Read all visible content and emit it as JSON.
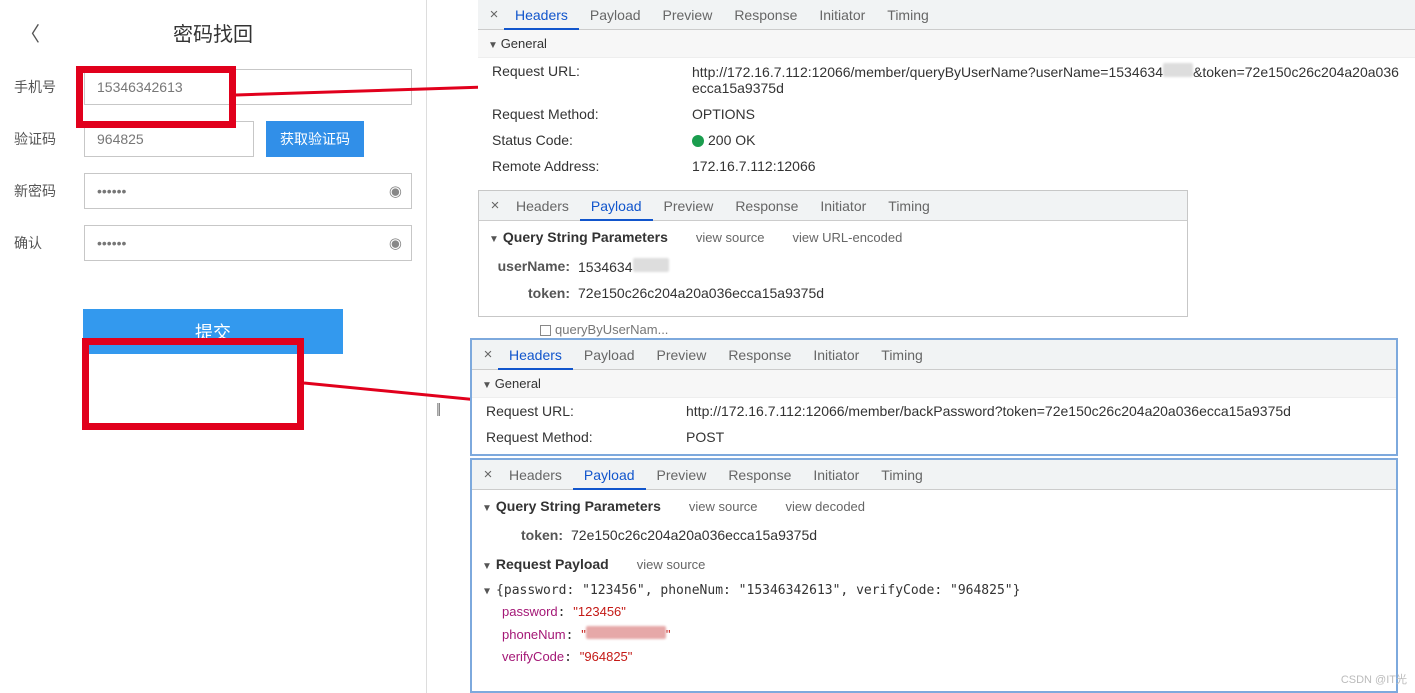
{
  "form": {
    "title": "密码找回",
    "labels": {
      "phone": "手机号",
      "code": "验证码",
      "newpwd": "新密码",
      "confirm": "确认"
    },
    "values": {
      "phone": "15346342613",
      "code": "964825",
      "newpwd_mask": "••••••",
      "confirm_mask": "••••••"
    },
    "get_code_btn": "获取验证码",
    "submit_btn": "提交"
  },
  "devtools1": {
    "tabs": [
      "Headers",
      "Payload",
      "Preview",
      "Response",
      "Initiator",
      "Timing"
    ],
    "active_tab": "Headers",
    "general_label": "General",
    "rows": {
      "req_url_k": "Request URL:",
      "req_url_v_p1": "http://172.16.7.112:12066/member/queryByUserName?userName=1534634",
      "req_url_v_p2": "&token=72e150c26c204a20a036ecca15a9375d",
      "req_method_k": "Request Method:",
      "req_method_v": "OPTIONS",
      "status_k": "Status Code:",
      "status_v": "200 OK",
      "remote_k": "Remote Address:",
      "remote_v": "172.16.7.112:12066"
    }
  },
  "devtools2": {
    "tabs": [
      "Headers",
      "Payload",
      "Preview",
      "Response",
      "Initiator",
      "Timing"
    ],
    "active_tab": "Payload",
    "qsp_label": "Query String Parameters",
    "view_source": "view source",
    "view_url": "view URL-encoded",
    "params": {
      "userName_k": "userName:",
      "userName_v": "1534634",
      "token_k": "token:",
      "token_v": "72e150c26c204a20a036ecca15a9375d"
    }
  },
  "network_item_label": "queryByUserNam...",
  "devtools3": {
    "tabs": [
      "Headers",
      "Payload",
      "Preview",
      "Response",
      "Initiator",
      "Timing"
    ],
    "active_tab": "Headers",
    "general_label": "General",
    "rows": {
      "req_url_k": "Request URL:",
      "req_url_v": "http://172.16.7.112:12066/member/backPassword?token=72e150c26c204a20a036ecca15a9375d",
      "req_method_k": "Request Method:",
      "req_method_v": "POST"
    }
  },
  "devtools4": {
    "tabs": [
      "Headers",
      "Payload",
      "Preview",
      "Response",
      "Initiator",
      "Timing"
    ],
    "active_tab": "Payload",
    "qsp_label": "Query String Parameters",
    "view_source": "view source",
    "view_decoded": "view decoded",
    "token_k": "token:",
    "token_v": "72e150c26c204a20a036ecca15a9375d",
    "rp_label": "Request Payload",
    "payload_raw": "{password: \"123456\", phoneNum: \"15346342613\", verifyCode: \"964825\"}",
    "payload": {
      "password_k": "password",
      "password_v": "\"123456\"",
      "phoneNum_k": "phoneNum",
      "phoneNum_v_smudged": "\"           \"",
      "verifyCode_k": "verifyCode",
      "verifyCode_v": "\"964825\""
    }
  },
  "watermark": "CSDN @IT光"
}
